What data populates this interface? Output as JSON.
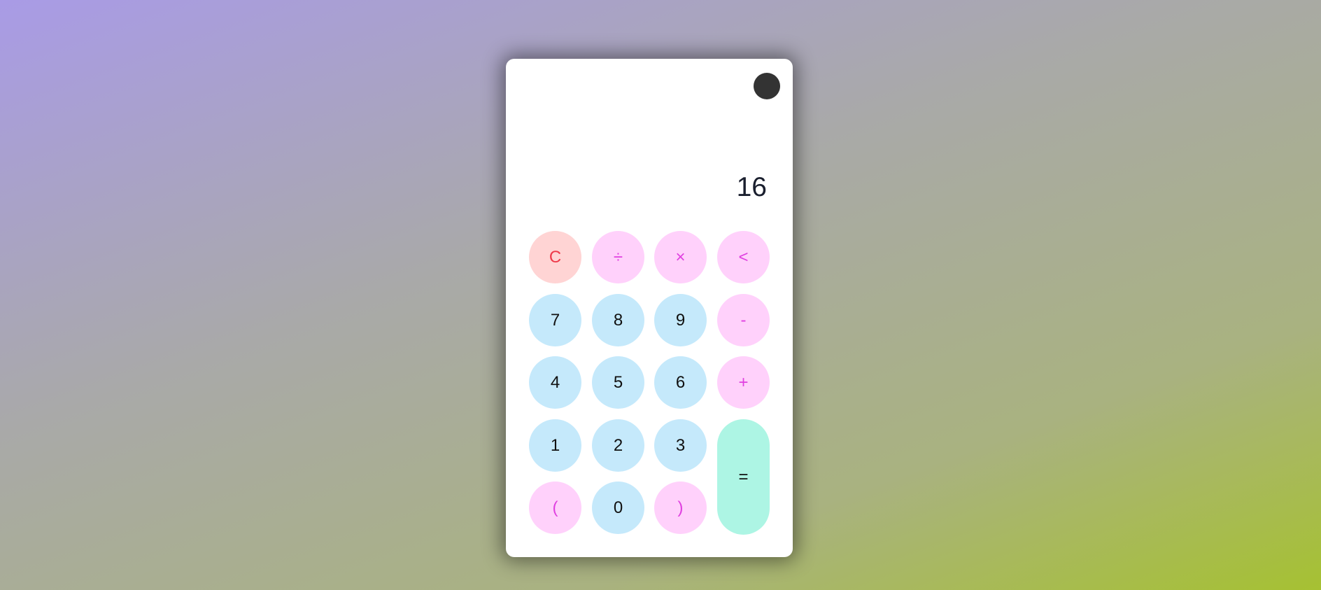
{
  "display": {
    "value": "16"
  },
  "keys": {
    "clear": "C",
    "divide": "÷",
    "multiply": "×",
    "backspace": "<",
    "seven": "7",
    "eight": "8",
    "nine": "9",
    "minus": "-",
    "four": "4",
    "five": "5",
    "six": "6",
    "plus": "+",
    "one": "1",
    "two": "2",
    "three": "3",
    "equals": "=",
    "open_paren": "(",
    "zero": "0",
    "close_paren": ")"
  },
  "colors": {
    "number_key_bg": "#c5e9fb",
    "operator_key_bg": "#ffd1fb",
    "operator_key_text": "#e040e0",
    "clear_key_bg": "#ffd4d4",
    "clear_key_text": "#ee3a4a",
    "equals_key_bg": "#adf5e4",
    "theme_toggle": "#333333"
  }
}
